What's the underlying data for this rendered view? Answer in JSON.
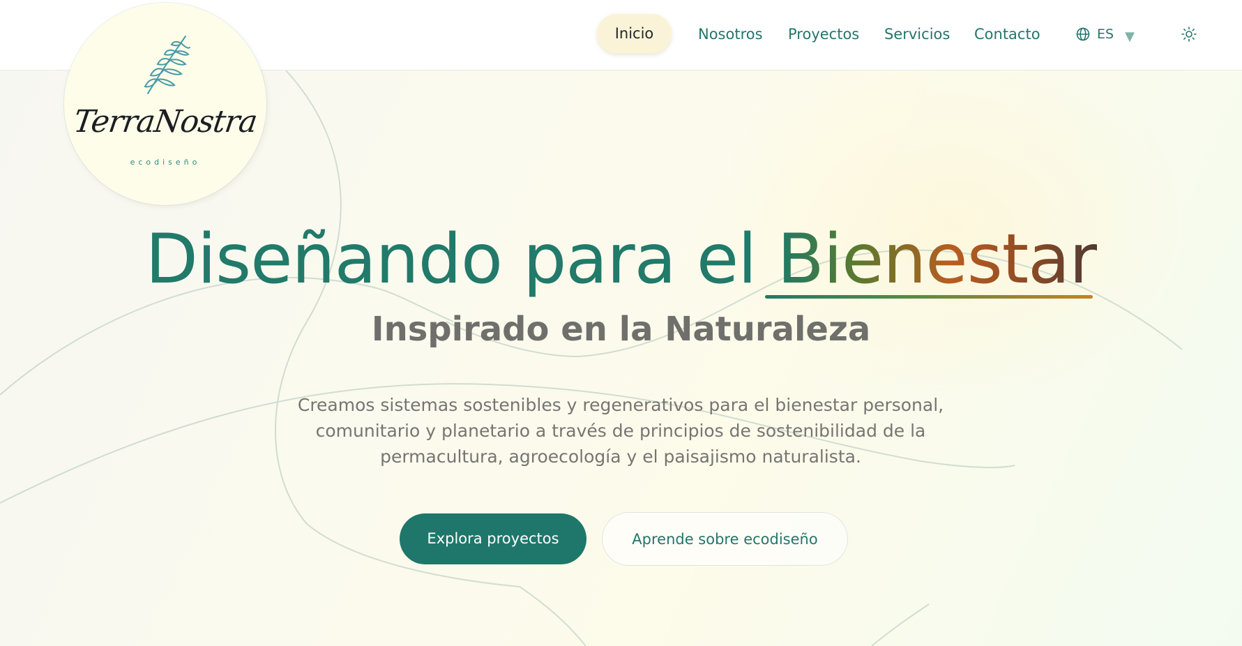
{
  "brand": {
    "name": "TerraNostra",
    "tagline": "ecodiseño"
  },
  "nav": {
    "items": [
      "Inicio",
      "Nosotros",
      "Proyectos",
      "Servicios",
      "Contacto"
    ],
    "active_index": 0,
    "language": "ES",
    "icons": {
      "language": "globe-icon",
      "dropdown": "chevron-down-icon",
      "theme": "sun-icon"
    }
  },
  "hero": {
    "title_part1": "Diseñando para el",
    "title_part2": "Bienestar",
    "subtitle": "Inspirado en la Naturaleza",
    "description_lines": [
      "Creamos sistemas sostenibles y regenerativos para el bienestar personal,",
      "comunitario y planetario a través de principios de sostenibilidad de la",
      "permacultura, agroecología y el paisajismo naturalista."
    ],
    "primary_cta": "Explora proyectos",
    "secondary_cta": "Aprende sobre ecodiseño"
  },
  "colors": {
    "primary": "#1e776a",
    "nav_text": "#24756b",
    "active_pill": "#fbf3d7",
    "accent_gradient_start": "#1f7a66",
    "accent_gradient_end": "#c8821e",
    "body_text": "#767573"
  }
}
